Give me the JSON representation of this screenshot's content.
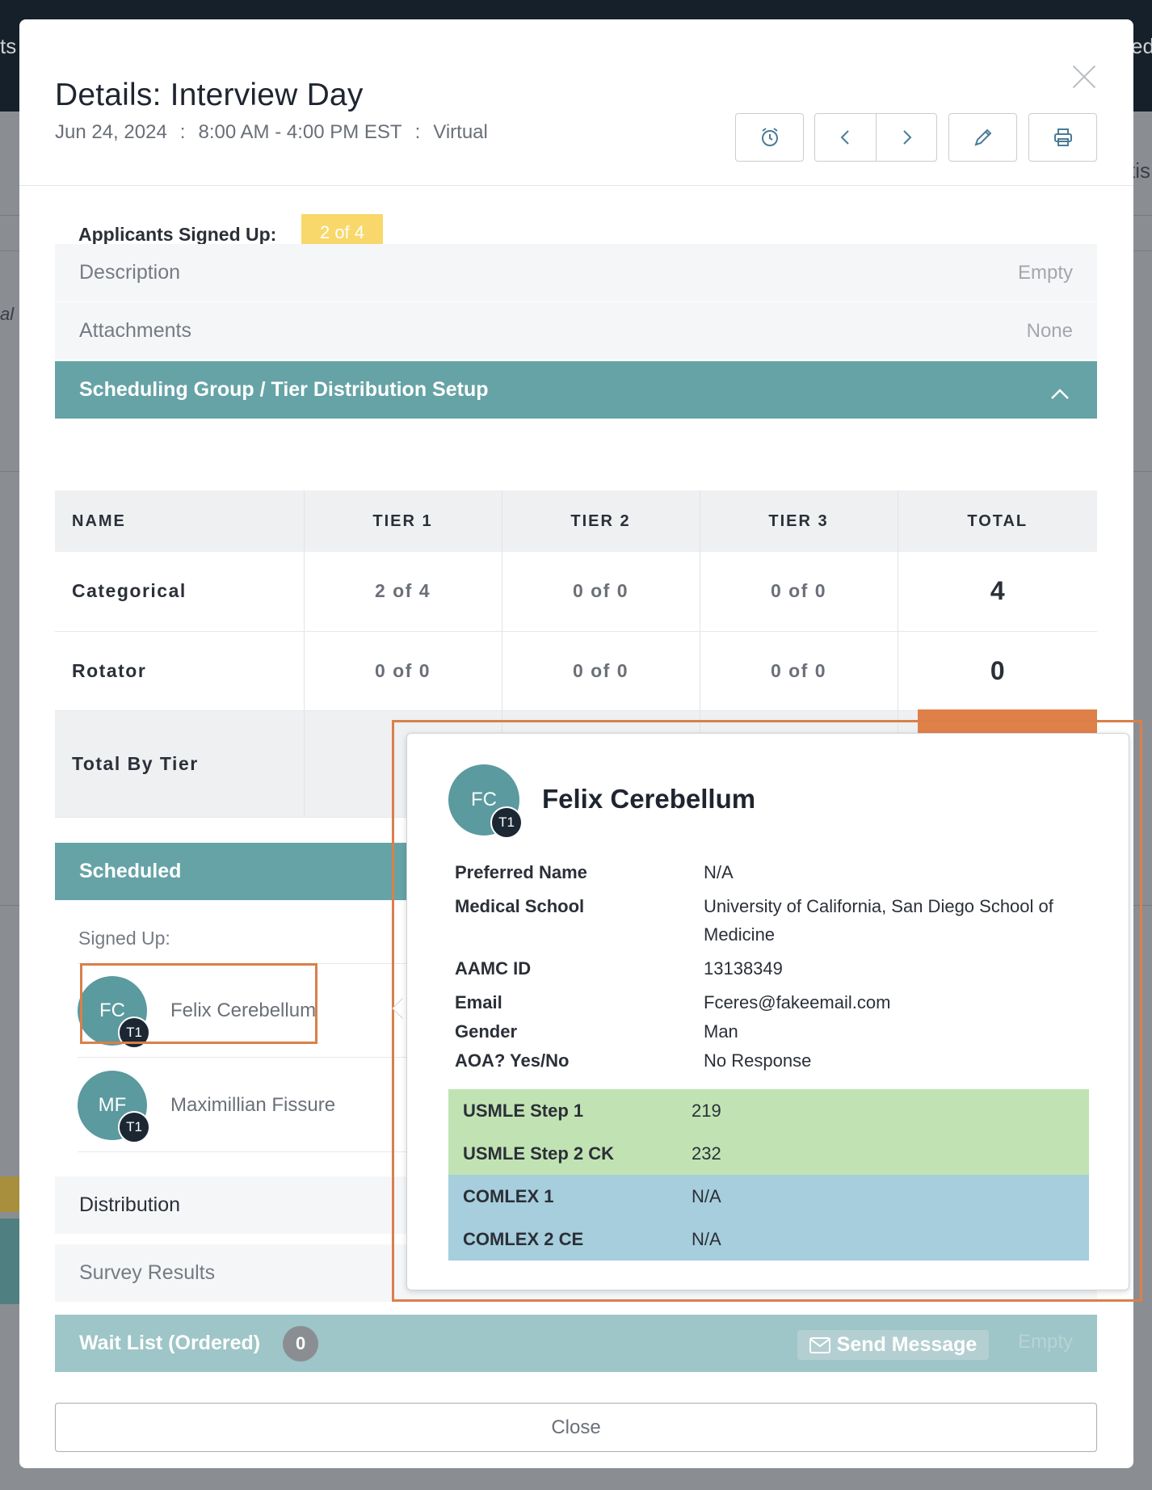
{
  "background": {
    "left_partial_top": "ts",
    "right_partial_top": "ed",
    "right_partial_mid": "tis",
    "left_partial_mid": "al"
  },
  "modal": {
    "title": "Details: Interview Day",
    "date": "Jun 24, 2024",
    "sep1": ":",
    "time": "8:00 AM - 4:00 PM EST",
    "sep2": ":",
    "location": "Virtual"
  },
  "toolbar": {
    "alarm_icon": "alarm-clock-icon",
    "prev_icon": "chevron-left-icon",
    "next_icon": "chevron-right-icon",
    "edit_icon": "pencil-icon",
    "print_icon": "printer-icon"
  },
  "signed_up": {
    "label": "Applicants Signed Up:",
    "value": "2 of 4"
  },
  "description": {
    "label": "Description",
    "value": "Empty"
  },
  "attachments": {
    "label": "Attachments",
    "value": "None"
  },
  "scheduling_group": {
    "label": "Scheduling Group / Tier Distribution Setup"
  },
  "tier_table": {
    "headers": [
      "NAME",
      "TIER 1",
      "TIER 2",
      "TIER 3",
      "TOTAL"
    ],
    "rows": [
      {
        "name": "Categorical",
        "tier1": "2 of 4",
        "tier2": "0 of 0",
        "tier3": "0 of 0",
        "total": "4"
      },
      {
        "name": "Rotator",
        "tier1": "0 of 0",
        "tier2": "0 of 0",
        "tier3": "0 of 0",
        "total": "0"
      }
    ],
    "total_by_tier": "Total By Tier"
  },
  "scheduled": {
    "label": "Scheduled",
    "signed_up_label": "Signed Up:",
    "people": [
      {
        "initials": "FC",
        "tier": "T1",
        "name": "Felix Cerebellum"
      },
      {
        "initials": "MF",
        "tier": "T1",
        "name": "Maximillian Fissure"
      }
    ]
  },
  "distribution": {
    "label": "Distribution"
  },
  "survey": {
    "label": "Survey Results"
  },
  "wait_list": {
    "label": "Wait List (Ordered)",
    "count": "0",
    "send_message": "Send Message",
    "empty": "Empty"
  },
  "close_label": "Close",
  "popover": {
    "initials": "FC",
    "tier": "T1",
    "name": "Felix Cerebellum",
    "fields": [
      {
        "k": "Preferred Name",
        "v": "N/A"
      },
      {
        "k": "Medical School",
        "v": "University of California, San Diego School of Medicine"
      },
      {
        "k": "AAMC ID",
        "v": "13138349"
      },
      {
        "k": "Email",
        "v": "Fceres@fakeemail.com"
      },
      {
        "k": "Gender",
        "v": "Man"
      },
      {
        "k": "AOA? Yes/No",
        "v": "No Response"
      }
    ],
    "usmle": [
      {
        "k": "USMLE Step 1",
        "v": "219"
      },
      {
        "k": "USMLE Step 2 CK",
        "v": "232"
      }
    ],
    "comlex": [
      {
        "k": "COMLEX 1",
        "v": "N/A"
      },
      {
        "k": "COMLEX 2 CE",
        "v": "N/A"
      }
    ]
  },
  "colors": {
    "teal": "#66a3a6",
    "badge_yellow": "#f8d86a",
    "highlight_orange": "#d9804a",
    "usmle_green": "#c1e3b4",
    "comlex_blue": "#a6cedc"
  }
}
